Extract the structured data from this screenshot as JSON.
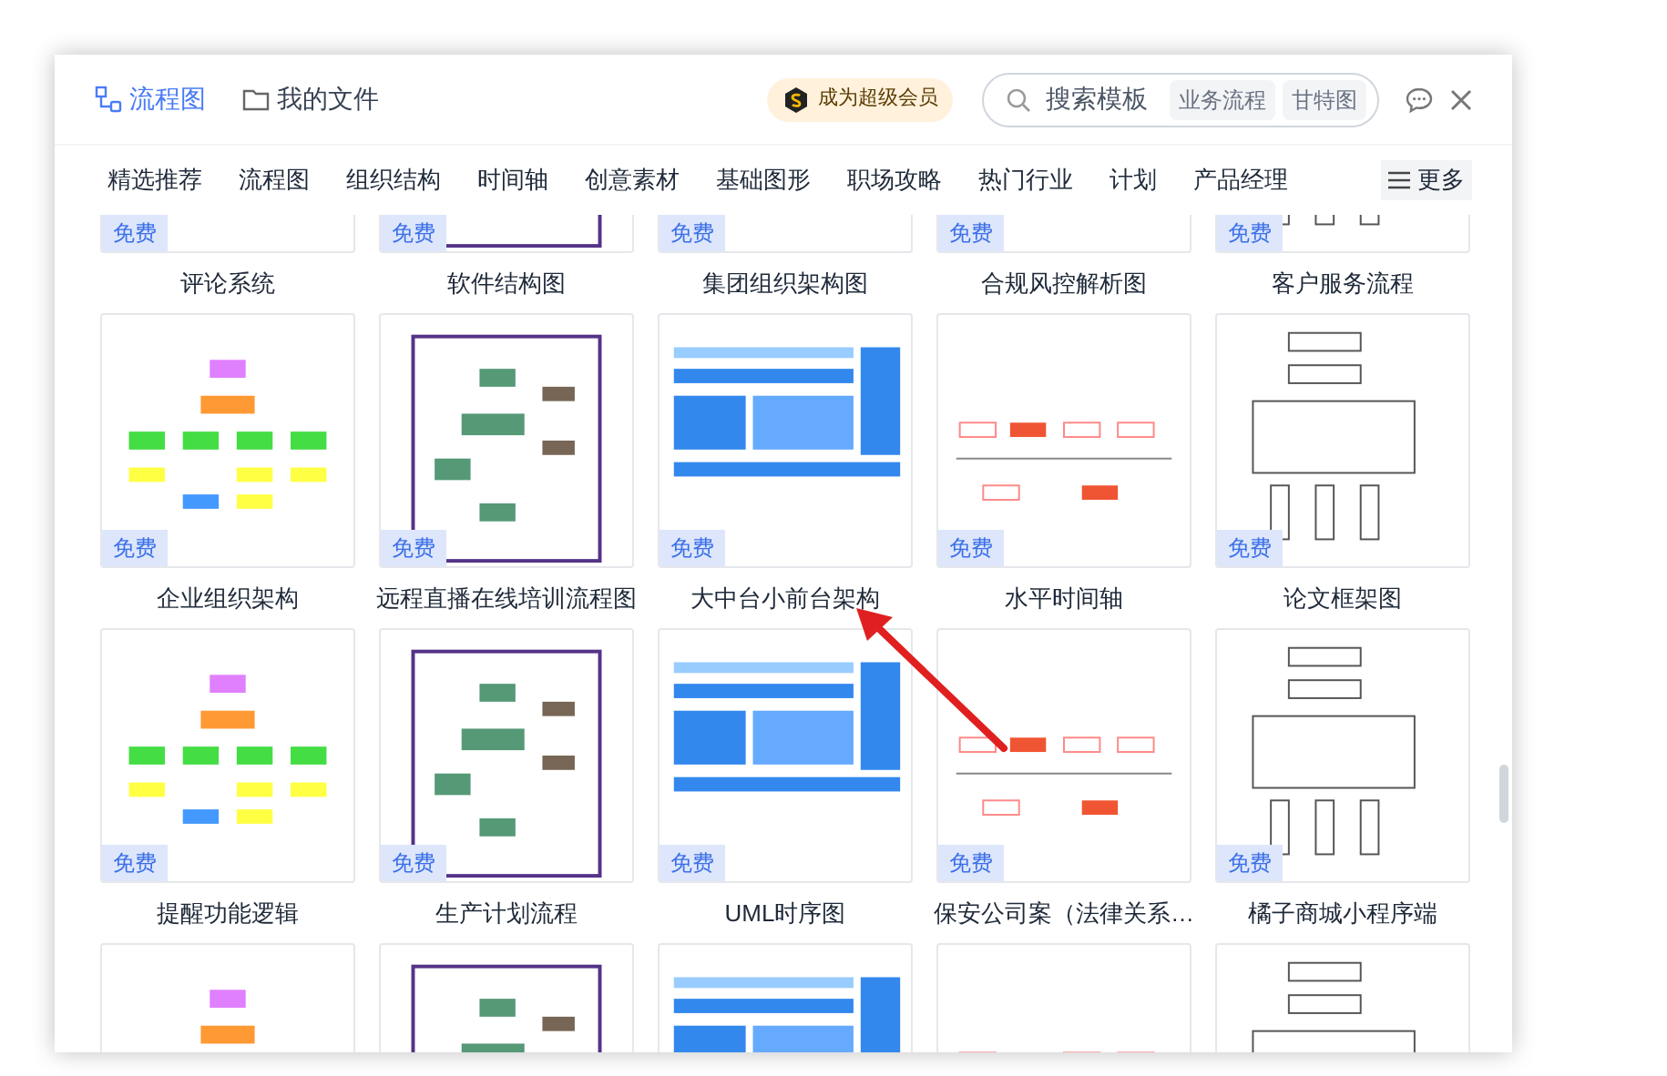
{
  "header": {
    "tabs": [
      {
        "label": "流程图",
        "selected": true
      },
      {
        "label": "我的文件",
        "selected": false
      }
    ],
    "vip_badge": "成为超级会员",
    "search": {
      "placeholder": "搜索模板",
      "tags": [
        "业务流程",
        "甘特图"
      ]
    }
  },
  "categories": [
    "精选推荐",
    "流程图",
    "组织结构",
    "时间轴",
    "创意素材",
    "基础图形",
    "职场攻略",
    "热门行业",
    "计划",
    "产品经理"
  ],
  "more_button": "更多",
  "cards": [
    {
      "badge": "免费"
    },
    {
      "badge": "免费"
    },
    {
      "badge": "免费"
    },
    {
      "badge": "免费"
    },
    {
      "badge": "免费"
    },
    {
      "title": "评论系统",
      "badge": "免费"
    },
    {
      "title": "软件结构图",
      "badge": "免费"
    },
    {
      "title": "集团组织架构图",
      "badge": "免费"
    },
    {
      "title": "合规风控解析图",
      "badge": "免费"
    },
    {
      "title": "客户服务流程",
      "badge": "免费"
    },
    {
      "title": "企业组织架构",
      "badge": "免费"
    },
    {
      "title": "远程直播在线培训流程图",
      "badge": "免费"
    },
    {
      "title": "大中台小前台架构",
      "badge": "免费"
    },
    {
      "title": "水平时间轴",
      "badge": "免费"
    },
    {
      "title": "论文框架图",
      "badge": "免费"
    },
    {
      "title": "提醒功能逻辑"
    },
    {
      "title": "生产计划流程"
    },
    {
      "title": "UML时序图"
    },
    {
      "title": "保安公司案（法律关系…"
    },
    {
      "title": "橘子商城小程序端"
    }
  ]
}
